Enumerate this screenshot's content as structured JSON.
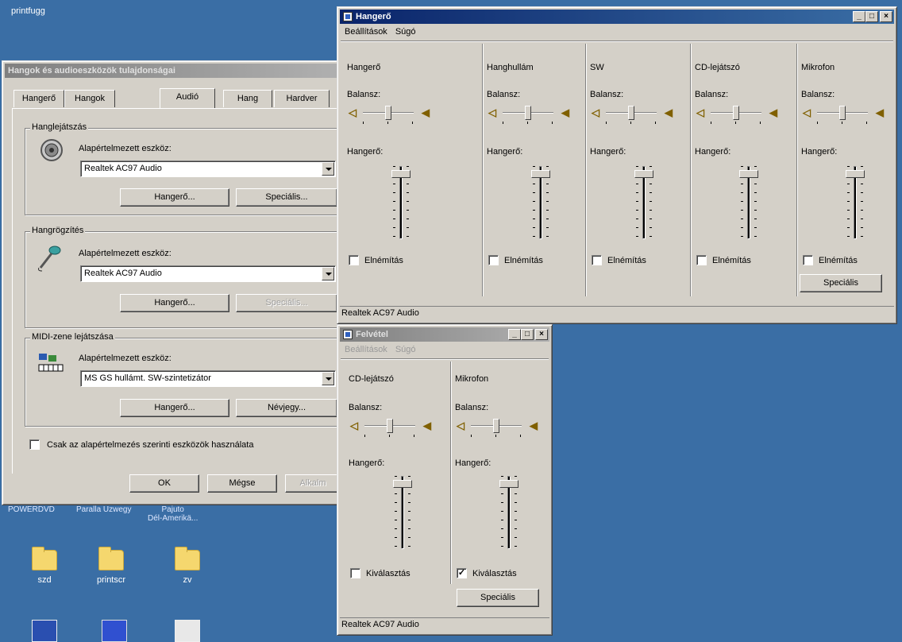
{
  "desktop": {
    "top_label": "printfugg",
    "row_labels": [
      "POWERDVD",
      "Paralla Uzwegy",
      "Pajuto\nDél-Amerikä..."
    ],
    "folders": [
      {
        "label": "szd",
        "icon": "folder-icon"
      },
      {
        "label": "printscr",
        "icon": "folder-icon"
      },
      {
        "label": "zv",
        "icon": "folder-icon"
      }
    ]
  },
  "props_dialog": {
    "title": "Hangok és audioeszközök tulajdonságai",
    "tabs": [
      "Hangerő",
      "Hangok",
      "Audió",
      "Hang",
      "Hardver"
    ],
    "active_tab": "Audió",
    "playback": {
      "group": "Hanglejátszás",
      "device_label": "Alapértelmezett eszköz:",
      "device_value": "Realtek AC97 Audio",
      "volume_button": "Hangerő...",
      "advanced_button": "Speciális..."
    },
    "recording": {
      "group": "Hangrögzítés",
      "device_label": "Alapértelmezett eszköz:",
      "device_value": "Realtek AC97 Audio",
      "volume_button": "Hangerő...",
      "advanced_button": "Speciális..."
    },
    "midi": {
      "group": "MIDI-zene lejátszása",
      "device_label": "Alapértelmezett eszköz:",
      "device_value": "MS GS hullámt. SW-szintetizátor",
      "volume_button": "Hangerő...",
      "about_button": "Névjegy..."
    },
    "default_only_checkbox": "Csak az alapértelmezés szerinti eszközök használata",
    "ok_button": "OK",
    "cancel_button": "Mégse",
    "apply_button": "Alkalm"
  },
  "volume_window": {
    "title": "Hangerő",
    "menu": [
      "Beállítások",
      "Súgó"
    ],
    "balance_label": "Balansz:",
    "volume_label": "Hangerő:",
    "mute_label": "Elnémítás",
    "advanced_button": "Speciális",
    "status": "Realtek AC97 Audio",
    "channels": [
      {
        "name": "Hangerő",
        "balance": 0.5,
        "volume": 0.9,
        "muted": false
      },
      {
        "name": "Hanghullám",
        "balance": 0.5,
        "volume": 0.9,
        "muted": false
      },
      {
        "name": "SW",
        "balance": 0.5,
        "volume": 0.9,
        "muted": false
      },
      {
        "name": "CD-lejátszó",
        "balance": 0.5,
        "volume": 0.9,
        "muted": false
      },
      {
        "name": "Mikrofon",
        "balance": 0.5,
        "volume": 0.9,
        "muted": false
      }
    ]
  },
  "recording_window": {
    "title": "Felvétel",
    "menu": [
      "Beállítások",
      "Súgó"
    ],
    "balance_label": "Balansz:",
    "volume_label": "Hangerő:",
    "select_label": "Kiválasztás",
    "advanced_button": "Speciális",
    "status": "Realtek AC97 Audio",
    "channels": [
      {
        "name": "CD-lejátszó",
        "balance": 0.5,
        "volume": 0.9,
        "selected": false
      },
      {
        "name": "Mikrofon",
        "balance": 0.5,
        "volume": 0.9,
        "selected": true
      }
    ]
  },
  "colors": {
    "desktop": "#3a6ea5",
    "title_active": "#0a246a",
    "face": "#d4d0c8"
  }
}
